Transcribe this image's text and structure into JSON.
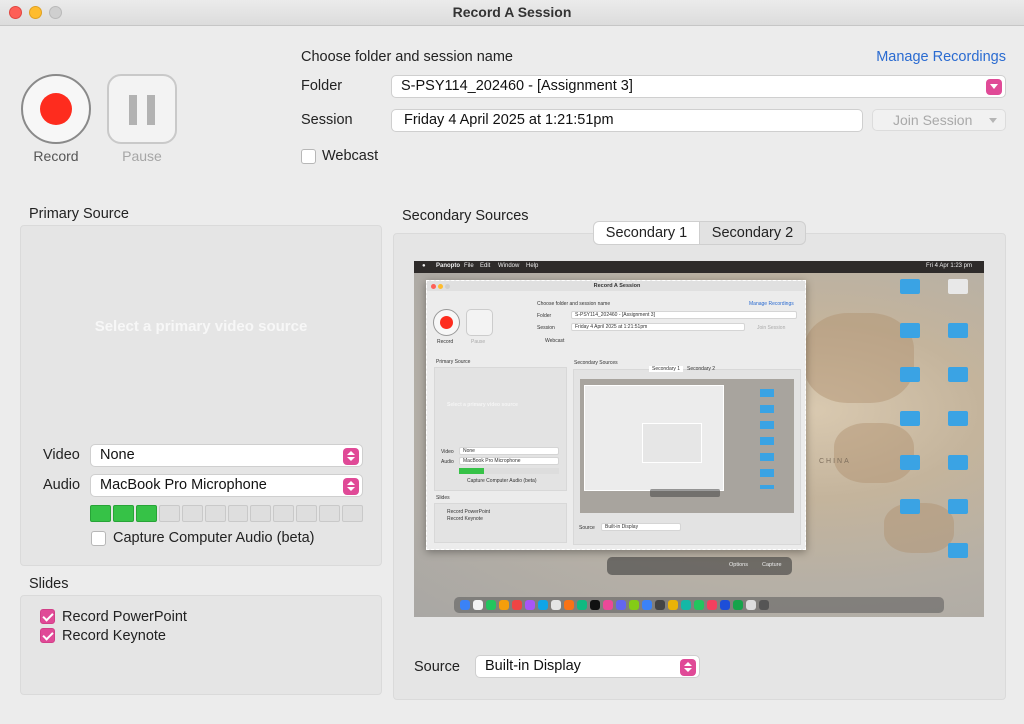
{
  "window": {
    "title": "Record A Session"
  },
  "controls": {
    "record_label": "Record",
    "pause_label": "Pause"
  },
  "session": {
    "header": "Choose folder and session name",
    "manage_link": "Manage Recordings",
    "folder_label": "Folder",
    "folder_value": "S-PSY114_202460 - [Assignment 3]",
    "session_label": "Session",
    "session_value": "Friday 4 April 2025 at 1:21:51pm",
    "join_label": "Join Session",
    "webcast_label": "Webcast",
    "webcast_checked": false
  },
  "primary": {
    "title": "Primary Source",
    "placeholder": "Select a primary video source",
    "video_label": "Video",
    "video_value": "None",
    "audio_label": "Audio",
    "audio_value": "MacBook Pro Microphone",
    "level_meter": {
      "segments": 12,
      "lit": 3
    },
    "capture_audio_label": "Capture Computer Audio (beta)",
    "capture_audio_checked": false
  },
  "slides": {
    "title": "Slides",
    "items": [
      {
        "label": "Record PowerPoint",
        "checked": true
      },
      {
        "label": "Record Keynote",
        "checked": true
      }
    ]
  },
  "secondary": {
    "title": "Secondary Sources",
    "tabs": [
      {
        "label": "Secondary 1",
        "active": true
      },
      {
        "label": "Secondary 2",
        "active": false
      }
    ],
    "source_label": "Source",
    "source_value": "Built-in Display",
    "preview": {
      "menubar": [
        "Panopto",
        "File",
        "Edit",
        "Window",
        "Help"
      ],
      "clock": "Fri 4 Apr  1:23 pm",
      "window_title": "Record A Session",
      "header": "Choose folder and session name",
      "manage_link": "Manage Recordings",
      "folder_label": "Folder",
      "folder_value": "S-PSY114_202460 - [Assignment 3]",
      "session_label": "Session",
      "session_value": "Friday 4 April 2025 at 1:21:51pm",
      "join_label": "Join Session",
      "webcast_label": "Webcast",
      "record_label": "Record",
      "pause_label": "Pause",
      "primary_title": "Primary Source",
      "placeholder": "Select a primary video source",
      "video_label": "Video",
      "video_value": "None",
      "audio_label": "Audio",
      "audio_value": "MacBook Pro Microphone",
      "capture_audio_label": "Capture Computer Audio (beta)",
      "slides_title": "Slides",
      "slides_items": [
        "Record PowerPoint",
        "Record Keynote"
      ],
      "secondary_title": "Secondary Sources",
      "tabs": [
        "Secondary 1",
        "Secondary 2"
      ],
      "source_label": "Source",
      "source_value": "Built-in Display",
      "toolbar_options": "Options",
      "toolbar_capture": "Capture",
      "map_text": "CHINA"
    }
  },
  "colors": {
    "accent": "#e04a97",
    "record_red": "#fe2c1e",
    "link_blue": "#2a6bd1",
    "meter_green": "#36c247"
  }
}
